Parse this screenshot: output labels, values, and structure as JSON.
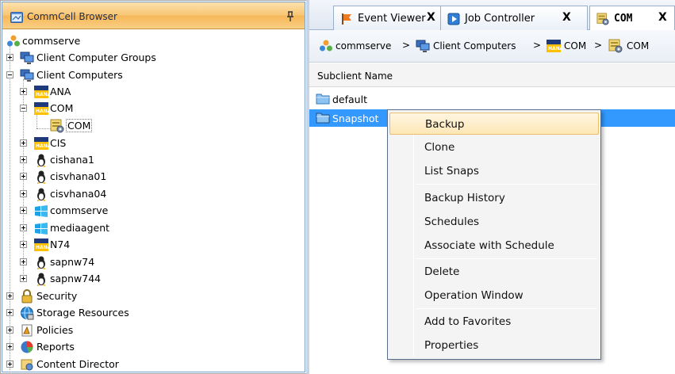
{
  "left_panel": {
    "title": "CommCell Browser",
    "tree": [
      {
        "label": "commserve",
        "icon": "commcell-icon"
      },
      {
        "label": "Client Computer Groups",
        "icon": "computer-group-icon"
      },
      {
        "label": "Client Computers",
        "icon": "computer-group-icon"
      },
      {
        "label": "ANA",
        "icon": "hana-icon"
      },
      {
        "label": "COM",
        "icon": "hana-icon"
      },
      {
        "label": "COM",
        "icon": "instance-icon",
        "selected": true
      },
      {
        "label": "CIS",
        "icon": "hana-icon"
      },
      {
        "label": "cishana1",
        "icon": "linux-icon"
      },
      {
        "label": "cisvhana01",
        "icon": "linux-icon"
      },
      {
        "label": "cisvhana04",
        "icon": "linux-icon"
      },
      {
        "label": "commserve",
        "icon": "windows-icon"
      },
      {
        "label": "mediaagent",
        "icon": "windows-icon"
      },
      {
        "label": "N74",
        "icon": "hana-icon"
      },
      {
        "label": "sapnw74",
        "icon": "linux-icon"
      },
      {
        "label": "sapnw744",
        "icon": "linux-icon"
      },
      {
        "label": "Security",
        "icon": "lock-icon"
      },
      {
        "label": "Storage Resources",
        "icon": "storage-icon"
      },
      {
        "label": "Policies",
        "icon": "policy-icon"
      },
      {
        "label": "Reports",
        "icon": "pie-chart-icon"
      },
      {
        "label": "Content Director",
        "icon": "content-director-icon"
      }
    ],
    "hana_text": "HANA"
  },
  "tabs": [
    {
      "label": "Event Viewer",
      "close": "X",
      "icon": "flag-icon"
    },
    {
      "label": "Job Controller",
      "close": "X",
      "icon": "play-icon"
    },
    {
      "label": "COM",
      "close": "X",
      "icon": "instance-icon",
      "active": true
    }
  ],
  "breadcrumb": {
    "items": [
      "commserve",
      "Client Computers",
      "COM",
      "COM"
    ],
    "separator": ">"
  },
  "grid": {
    "column_header": "Subclient Name",
    "rows": [
      {
        "name": "default",
        "icon": "folder-icon"
      },
      {
        "name": "Snapshot",
        "icon": "folder-icon",
        "selected": true
      }
    ]
  },
  "context_menu": {
    "groups": [
      [
        "Backup",
        "Clone",
        "List Snaps"
      ],
      [
        "Backup History",
        "Schedules",
        "Associate with Schedule"
      ],
      [
        "Delete",
        "Operation Window"
      ],
      [
        "Add to Favorites",
        "Properties"
      ]
    ],
    "highlighted": "Backup"
  },
  "colors": {
    "title_bar_orange": "#f8c574",
    "selection_blue": "#3399ff",
    "hana_yellow": "#ffc000",
    "hana_navy": "#1f3a7a"
  }
}
